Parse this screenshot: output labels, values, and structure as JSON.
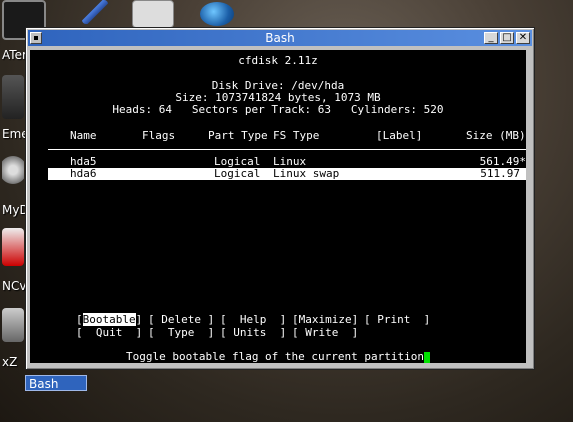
{
  "desktop": {
    "icons": [
      {
        "label": "ATer",
        "icon": "terminal-icon"
      },
      {
        "label": "Eme",
        "icon": "computer-icon"
      },
      {
        "label": "MyD",
        "icon": "gear-icon"
      },
      {
        "label": "NCv",
        "icon": "ncview-icon"
      },
      {
        "label": "xZ",
        "icon": "app-icon"
      }
    ],
    "top_icons": [
      "pen-icon",
      "settings-panel-icon",
      "globe-icon"
    ]
  },
  "window": {
    "title": "Bash",
    "controls": {
      "minimize": "_",
      "maximize": "□",
      "close": "✕"
    }
  },
  "cfdisk": {
    "title": "cfdisk 2.11z",
    "disk_drive": "Disk Drive: /dev/hda",
    "size_line": "Size: 1073741824 bytes, 1073 MB",
    "geometry_line": "Heads: 64   Sectors per Track: 63   Cylinders: 520",
    "headers": {
      "name": "Name",
      "flags": "Flags",
      "part_type": "Part Type",
      "fs_type": "FS Type",
      "label": "[Label]",
      "size": "Size (MB)"
    },
    "partitions": [
      {
        "name": "hda5",
        "flags": "",
        "part_type": "Logical",
        "fs_type": "Linux",
        "label": "",
        "size": "561.49*"
      },
      {
        "name": "hda6",
        "flags": "",
        "part_type": "Logical",
        "fs_type": "Linux swap",
        "label": "",
        "size": "511.97"
      }
    ],
    "menu_row1": [
      {
        "label": "Bootable",
        "selected": true
      },
      {
        "label": "[ Delete ]"
      },
      {
        "label": "[  Help  ]"
      },
      {
        "label": "[Maximize]"
      },
      {
        "label": "[ Print  ]"
      }
    ],
    "menu_row2": [
      {
        "label": "[  Quit  ]"
      },
      {
        "label": "[  Type  ]"
      },
      {
        "label": "[ Units  ]"
      },
      {
        "label": "[ Write  ]"
      }
    ],
    "status": "Toggle bootable flag of the current partition"
  },
  "taskbar": {
    "button_label": "Bash"
  },
  "colors": {
    "titlebar": "#2f64bd",
    "terminal_bg": "#000000",
    "cursor": "#00e000"
  }
}
